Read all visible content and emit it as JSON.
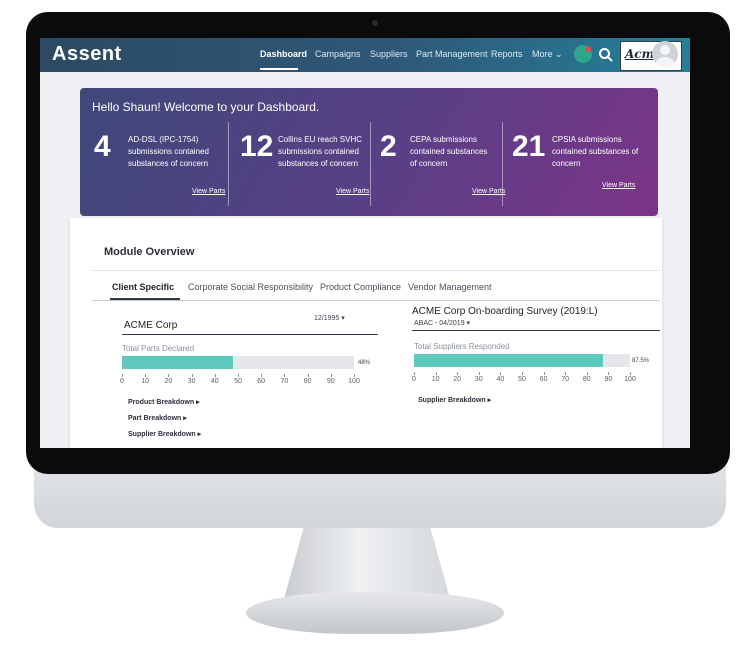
{
  "nav": {
    "logo": "Assent",
    "items": [
      "Dashboard",
      "Campaigns",
      "Suppliers",
      "Part Management",
      "Reports",
      "More ⌄"
    ],
    "brand": "Acme"
  },
  "welcome": {
    "title": "Hello Shaun! Welcome to your Dashboard.",
    "stats": [
      {
        "number": "4",
        "text": "AD-DSL (IPC-1754) submissions contained substances of concern",
        "link": "View Parts"
      },
      {
        "number": "12",
        "text": "Collins EU reach SVHC submissions contained substances of concern",
        "link": "View Parts"
      },
      {
        "number": "2",
        "text": "CEPA submissions contained substances of concern",
        "link": "View Parts"
      },
      {
        "number": "21",
        "text": "CPSIA submissions contained substances of concern",
        "link": "View Parts"
      }
    ]
  },
  "module": {
    "title": "Module Overview",
    "tabs": [
      "Client Specific",
      "Corporate Social Responsibility",
      "Product Compliance",
      "Vendor Management"
    ],
    "left": {
      "title": "ACME Corp",
      "date": "12/1995 ▾",
      "bar_label": "Total Parts Declared",
      "percent_text": "48%",
      "percent": 48,
      "ticks": [
        "0",
        "10",
        "20",
        "30",
        "40",
        "50",
        "60",
        "70",
        "80",
        "90",
        "100"
      ],
      "links": [
        "Product Breakdown ▸",
        "Part Breakdown ▸",
        "Supplier Breakdown ▸"
      ]
    },
    "right": {
      "title": "ACME Corp  On-boarding Survey (2019:L)",
      "date": "ABAC - 04/2019 ▾",
      "bar_label": "Total Suppliers Responded",
      "percent_text": "87.5%",
      "percent": 87.5,
      "ticks": [
        "0",
        "10",
        "20",
        "30",
        "40",
        "50",
        "60",
        "70",
        "80",
        "90",
        "100"
      ],
      "links": [
        "Supplier Breakdown ▸"
      ]
    }
  }
}
